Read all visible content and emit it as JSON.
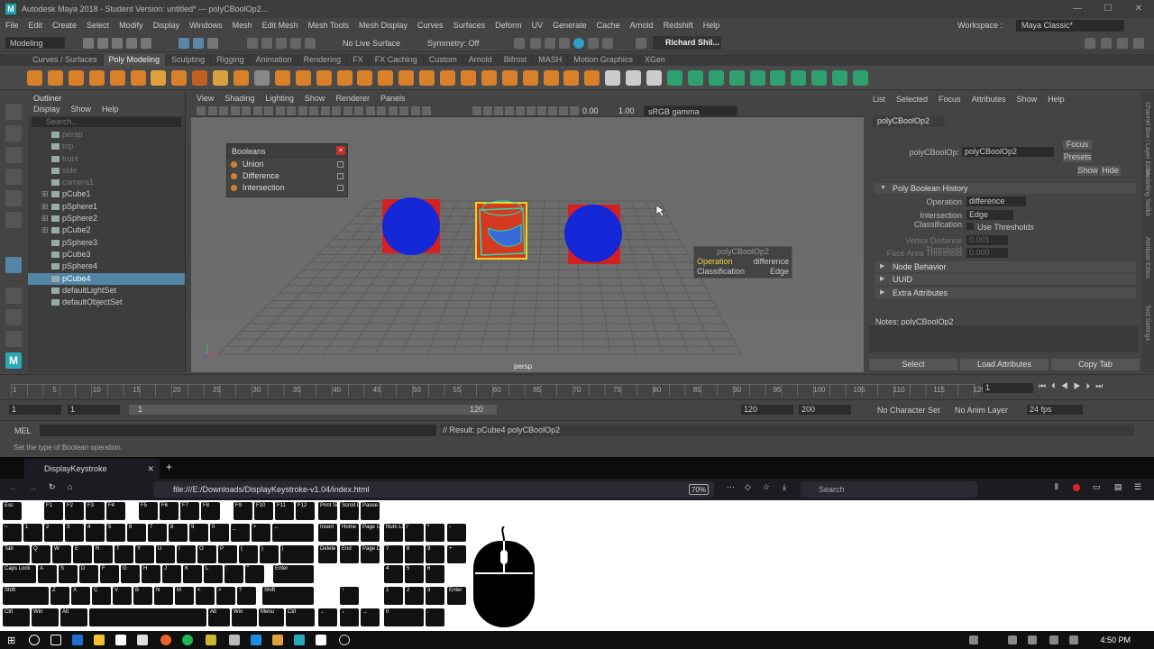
{
  "window": {
    "title": "Autodesk Maya 2018 - Student Version: untitled*   ---   polyCBoolOp2...",
    "logo": "M"
  },
  "menus": [
    "File",
    "Edit",
    "Create",
    "Select",
    "Modify",
    "Display",
    "Windows",
    "Mesh",
    "Edit Mesh",
    "Mesh Tools",
    "Mesh Display",
    "Curves",
    "Surfaces",
    "Deform",
    "UV",
    "Generate",
    "Cache",
    "Arnold",
    "Redshift",
    "Help"
  ],
  "workspace": {
    "label": "Workspace :",
    "value": "Maya Classic*"
  },
  "status": {
    "mode": "Modeling",
    "live": "No Live Surface",
    "symmetry": "Symmetry: Off",
    "user": "Richard Shil..."
  },
  "shelf_tabs": [
    "Curves / Surfaces",
    "Poly Modeling",
    "Sculpting",
    "Rigging",
    "Animation",
    "Rendering",
    "FX",
    "FX Caching",
    "Custom",
    "Arnold",
    "Bifrost",
    "MASH",
    "Motion Graphics",
    "XGen"
  ],
  "shelf_active": "Poly Modeling",
  "outliner": {
    "title": "Outliner",
    "menu": [
      "Display",
      "Show",
      "Help"
    ],
    "search": "Search...",
    "items": [
      {
        "name": "persp",
        "dim": true,
        "plus": false
      },
      {
        "name": "top",
        "dim": true,
        "plus": false
      },
      {
        "name": "front",
        "dim": true,
        "plus": false
      },
      {
        "name": "side",
        "dim": true,
        "plus": false
      },
      {
        "name": "camera1",
        "dim": true,
        "plus": false
      },
      {
        "name": "pCube1",
        "dim": false,
        "plus": true
      },
      {
        "name": "pSphere1",
        "dim": false,
        "plus": true
      },
      {
        "name": "pSphere2",
        "dim": false,
        "plus": true
      },
      {
        "name": "pCube2",
        "dim": false,
        "plus": true
      },
      {
        "name": "pSphere3",
        "dim": false,
        "plus": false
      },
      {
        "name": "pCube3",
        "dim": false,
        "plus": false
      },
      {
        "name": "pSphere4",
        "dim": false,
        "plus": false
      },
      {
        "name": "pCube4",
        "dim": false,
        "plus": false,
        "selected": true
      },
      {
        "name": "defaultLightSet",
        "dim": false,
        "plus": false
      },
      {
        "name": "defaultObjectSet",
        "dim": false,
        "plus": false
      }
    ]
  },
  "viewport": {
    "menu": [
      "View",
      "Shading",
      "Lighting",
      "Show",
      "Renderer",
      "Panels"
    ],
    "v1": "0.00",
    "v2": "1.00",
    "gamma": "sRGB gamma",
    "camera": "persp"
  },
  "booleans": {
    "title": "Booleans",
    "items": [
      "Union",
      "Difference",
      "Intersection"
    ]
  },
  "hud": {
    "title": "polyCBoolOp2",
    "op_label": "Operation",
    "op_value": "difference",
    "cls_label": "Classification",
    "cls_value": "Edge"
  },
  "attr": {
    "menu": [
      "List",
      "Selected",
      "Focus",
      "Attributes",
      "Show",
      "Help"
    ],
    "tab": "polyCBoolOp2",
    "node_label": "polyCBoolOp:",
    "node_value": "polyCBoolOp2",
    "focus": "Focus",
    "presets": "Presets",
    "show": "Show",
    "hide": "Hide",
    "section_open": "Poly Boolean History",
    "operation_label": "Operation",
    "operation_value": "difference",
    "ic_label": "Intersection Classification",
    "ic_value": "Edge",
    "use_thr": "Use Thresholds",
    "vdt_label": "Vertex Distance Threshold",
    "vdt_value": "0.001",
    "fat_label": "Face Area Threshold",
    "fat_value": "0.000",
    "sections": [
      "Node Behavior",
      "UUID",
      "Extra Attributes"
    ],
    "notes": "Notes:  polyCBoolOp2",
    "btn_select": "Select",
    "btn_load": "Load Attributes",
    "btn_copy": "Copy Tab"
  },
  "side_tabs": [
    "Channel Box / Layer Editor",
    "Modelling Toolkit",
    "Attribute Editor",
    "Tool Settings"
  ],
  "timeline": {
    "labels": [
      "1",
      "5",
      "10",
      "15",
      "20",
      "25",
      "30",
      "35",
      "40",
      "45",
      "50",
      "55",
      "60",
      "65",
      "70",
      "75",
      "80",
      "85",
      "90",
      "95",
      "100",
      "105",
      "110",
      "115",
      "120"
    ],
    "current": "1"
  },
  "range": {
    "start": "1",
    "start2": "1",
    "inner_start": "1",
    "inner_end": "120",
    "end": "120",
    "end2": "200",
    "char": "No Character Set",
    "anim": "No Anim Layer",
    "fps": "24 fps"
  },
  "mel": {
    "label": "MEL",
    "result": "// Result: pCube4 polyCBoolOp2"
  },
  "helpline": "Set the type of Boolean operation.",
  "browser": {
    "tab": "DisplayKeystroke",
    "url": "file:///E:/Downloads/DisplayKeystroke-v1.04/index.html",
    "zoom": "70%",
    "search": "Search"
  },
  "keys": {
    "row0": [
      "Esc",
      "F1",
      "F2",
      "F3",
      "F4",
      "F5",
      "F6",
      "F7",
      "F8",
      "F9",
      "F10",
      "F11",
      "F12",
      "Print Screen",
      "Scroll Lock",
      "Pause Break"
    ],
    "row1": [
      "~",
      "1",
      "2",
      "3",
      "4",
      "5",
      "6",
      "7",
      "8",
      "9",
      "0",
      "_",
      "+",
      "←",
      "Insert",
      "Home",
      "Page Up",
      "Num Lock",
      "/",
      "*",
      "-"
    ],
    "row2": [
      "Tab",
      "Q",
      "W",
      "E",
      "R",
      "T",
      "Y",
      "U",
      "I",
      "O",
      "P",
      "{",
      "}",
      "|",
      "Delete",
      "End",
      "Page Down",
      "7",
      "8",
      "9",
      "+"
    ],
    "row3": [
      "Caps Lock",
      "A",
      "S",
      "D",
      "F",
      "G",
      "H",
      "J",
      "K",
      "L",
      ":",
      "\"",
      "Enter",
      "4",
      "5",
      "6"
    ],
    "row4": [
      "Shift",
      "Z",
      "X",
      "C",
      "V",
      "B",
      "N",
      "M",
      "<",
      ">",
      "?",
      "Shift",
      "↑",
      "1",
      "2",
      "3",
      "Enter"
    ],
    "row5": [
      "Ctrl",
      "Win",
      "Alt",
      "Alt",
      "Win",
      "Menu",
      "Ctrl",
      "←",
      "↓",
      "→",
      "0",
      "."
    ]
  },
  "taskbar": {
    "time": "4:50 PM"
  }
}
